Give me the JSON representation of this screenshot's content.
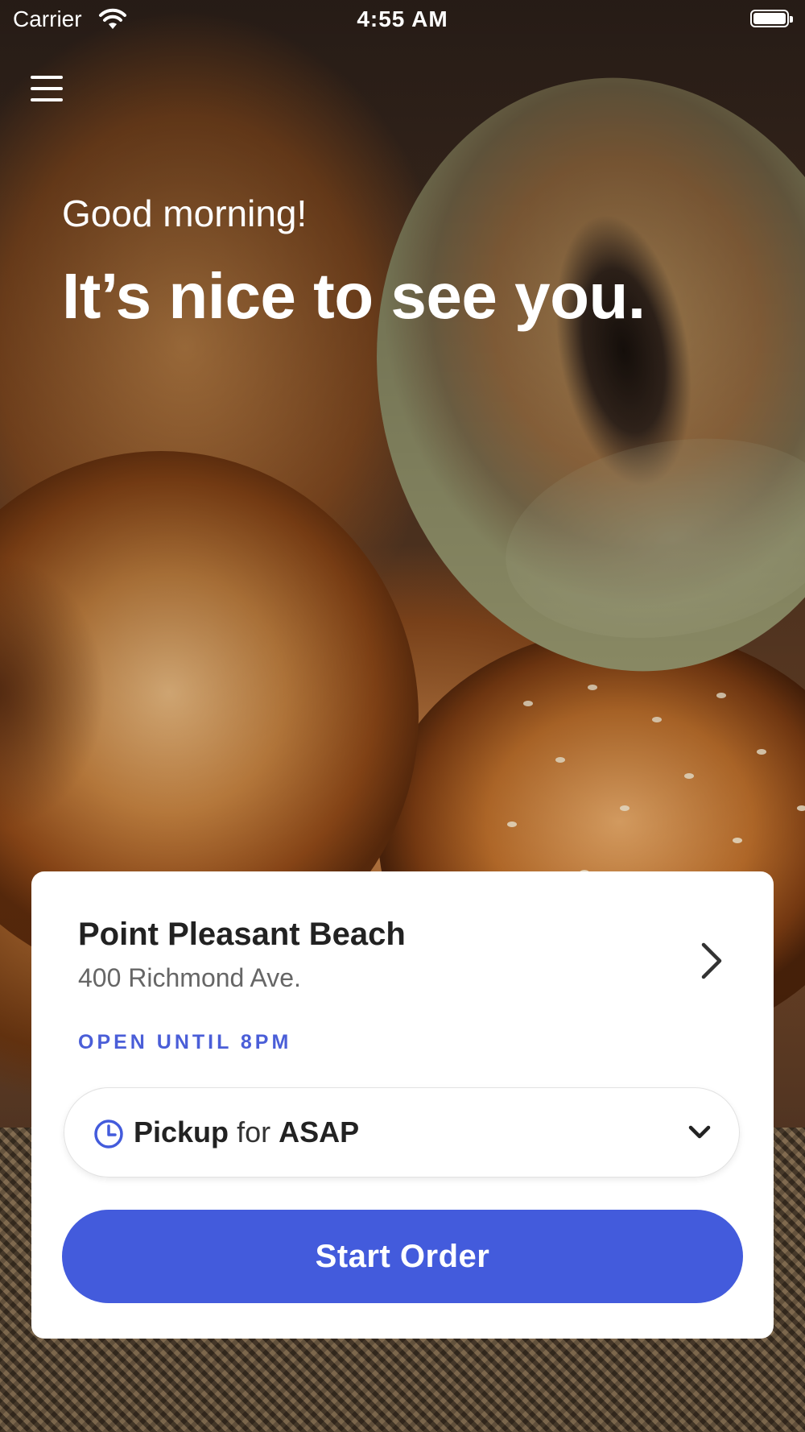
{
  "status_bar": {
    "carrier": "Carrier",
    "time": "4:55 AM"
  },
  "hero": {
    "greeting": "Good morning!",
    "headline": "It’s nice to see you.",
    "background": "bagels-photo"
  },
  "location_card": {
    "name": "Point Pleasant Beach",
    "address": "400 Richmond Ave.",
    "hours": "OPEN UNTIL 8PM",
    "pickup": {
      "mode": "Pickup",
      "connector": "for",
      "time": "ASAP",
      "icon": "clock-icon"
    },
    "start_order_label": "Start Order"
  },
  "colors": {
    "accent": "#435bdc",
    "hours_text": "#4a5ed8"
  }
}
